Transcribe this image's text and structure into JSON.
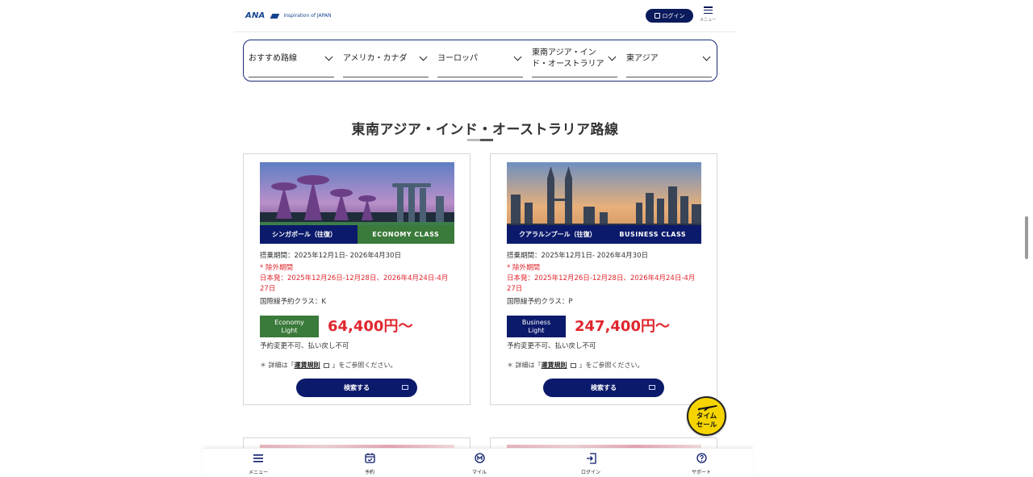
{
  "header": {
    "logo_main": "ANA",
    "logo_sub": "Inspiration of JAPAN",
    "login_label": "ログイン",
    "menu_label": "メニュー"
  },
  "route_tabs": [
    {
      "label": "おすすめ路線"
    },
    {
      "label": "アメリカ・カナダ"
    },
    {
      "label": "ヨーロッパ"
    },
    {
      "label_line1": "東南アジア・イン",
      "label_line2": "ド・オーストラリア"
    },
    {
      "label": "東アジア"
    }
  ],
  "section": {
    "title": "東南アジア・インド・オーストラリア路線"
  },
  "cards": [
    {
      "city": "シンガポール（往復）",
      "cabin": "ECONOMY CLASS",
      "cabin_color": "#3a7a3a",
      "period": "搭乗期間：2025年12月1日- 2026年4月30日",
      "exclusion_title": "* 除外期間",
      "exclusion_detail": "日本発：2025年12月26日-12月28日、2026年4月24日-4月27日",
      "booking_class": "国際線予約クラス：K",
      "fare_type_line1": "Economy",
      "fare_type_line2": "Light",
      "price": "64,400円～",
      "conditions": "予約変更不可、払い戻し不可",
      "note_prefix": "＊ 詳細は「",
      "note_link": "運賃規則",
      "note_suffix": "」をご参照ください。",
      "search_label": "検索する"
    },
    {
      "city": "クアラルンプール（往復）",
      "cabin": "BUSINESS CLASS",
      "cabin_color": "#0b1a6b",
      "period": "搭乗期間：2025年12月1日- 2026年4月30日",
      "exclusion_title": "* 除外期間",
      "exclusion_detail": "日本発：2025年12月26日-12月28日、2026年4月24日-4月27日",
      "booking_class": "国際線予約クラス：P",
      "fare_type_line1": "Business",
      "fare_type_line2": "Light",
      "price": "247,400円～",
      "conditions": "予約変更不可、払い戻し不可",
      "note_prefix": "＊ 詳細は「",
      "note_link": "運賃規則",
      "note_suffix": "」をご参照ください。",
      "search_label": "検索する"
    }
  ],
  "time_sale": {
    "line1": "タイム",
    "line2": "セール"
  },
  "bottom_nav": [
    {
      "label": "メニュー",
      "icon": "menu-icon"
    },
    {
      "label": "予約",
      "icon": "calendar-icon"
    },
    {
      "label": "マイル",
      "icon": "mile-icon"
    },
    {
      "label": "ログイン",
      "icon": "login-icon"
    },
    {
      "label": "サポート",
      "icon": "help-icon"
    }
  ],
  "colors": {
    "brand_navy": "#0b1a6b",
    "price_red": "#e0262e",
    "economy_green": "#3a7a3a",
    "time_sale_yellow": "#f5d400"
  }
}
